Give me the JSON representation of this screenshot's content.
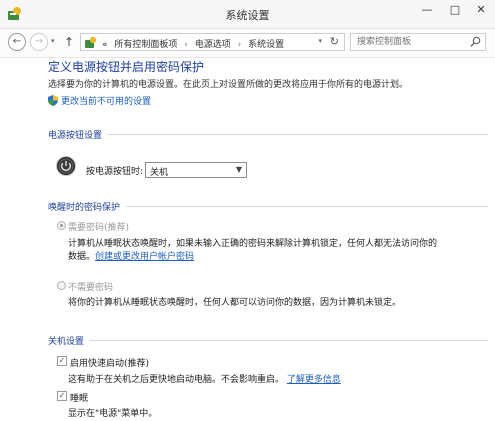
{
  "window": {
    "title": "系统设置",
    "minimize_glyph": "—",
    "maximize_glyph": "□",
    "close_glyph": "✕"
  },
  "address": {
    "back_glyph": "←",
    "forward_glyph": "→",
    "up_glyph": "↑",
    "overflow": "«",
    "crumbs": [
      "所有控制面板项",
      "电源选项",
      "系统设置"
    ],
    "refresh_glyph": "↻",
    "search_placeholder": "搜索控制面板"
  },
  "page": {
    "title": "定义电源按钮并启用密码保护",
    "subtitle": "选择要为你的计算机的电源设置。在此页上对设置所做的更改将应用于你所有的电源计划。",
    "change_unavailable_link": "更改当前不可用的设置"
  },
  "power_button": {
    "section_label": "电源按钮设置",
    "label": "按电源按钮时:",
    "selected_value": "关机"
  },
  "wake_password": {
    "section_label": "唤醒时的密码保护",
    "require": {
      "label": "需要密码(推荐)",
      "checked": true,
      "desc_line1": "计算机从睡眠状态唤醒时，如果未输入正确的密码来解除计算机锁定，任何人都无法访问你的",
      "desc_line2_prefix": "数据。",
      "desc_link": "创建或更改用户帐户密码"
    },
    "no_require": {
      "label": "不需要密码",
      "checked": false,
      "desc": "将你的计算机从睡眠状态唤醒时，任何人都可以访问你的数据，因为计算机未锁定。"
    }
  },
  "shutdown": {
    "section_label": "关机设置",
    "fast_startup": {
      "label": "启用快速启动(推荐)",
      "checked": true,
      "desc": "这有助于在关机之后更快地启动电脑。不会影响重启。",
      "learn_more": "了解更多信息"
    },
    "sleep": {
      "label": "睡眠",
      "checked": true,
      "desc": "显示在\"电源\"菜单中。"
    }
  },
  "check_glyph": "✓"
}
